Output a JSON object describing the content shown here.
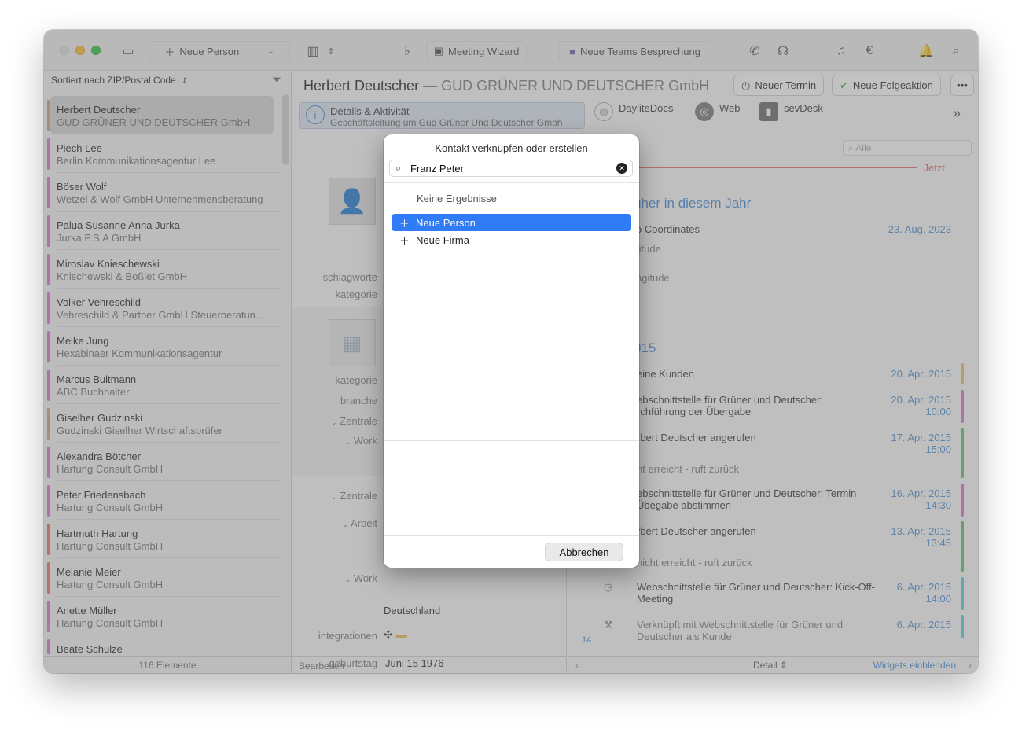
{
  "toolbar": {
    "new_person": "Neue Person",
    "meeting_wizard": "Meeting Wizard",
    "teams_meeting": "Neue Teams Besprechung"
  },
  "sidebar": {
    "sort_label": "Sortiert nach ZIP/Postal Code",
    "footer": "116 Elemente",
    "items": [
      {
        "name": "Herbert Deutscher",
        "company": "GUD GRÜNER UND DEUTSCHER GmbH",
        "color": "#c9a07a"
      },
      {
        "name": "Piech Lee",
        "company": "Berlin Kommunikationsagentur Lee",
        "color": "#d86fd6"
      },
      {
        "name": "Böser Wolf",
        "company": "Wetzel & Wolf GmbH Unternehmensberatung",
        "color": "#d86fd6"
      },
      {
        "name": "Palua Susanne Anna Jurka",
        "company": "Jurka P.S.A GmbH",
        "color": "#d86fd6"
      },
      {
        "name": "Miroslav Knieschewski",
        "company": "Knischewski & Boßlet GmbH",
        "color": "#d86fd6"
      },
      {
        "name": "Volker Vehreschild",
        "company": "Vehreschild & Partner GmbH Steuerberatun...",
        "color": "#d86fd6"
      },
      {
        "name": "Meike Jung",
        "company": "Hexabinaer Kommunikationsagentur",
        "color": "#d86fd6"
      },
      {
        "name": "Marcus Bultmann",
        "company": "ABC Buchhalter",
        "color": "#d86fd6"
      },
      {
        "name": "Giselher Gudzinski",
        "company": "Gudzinski Giselher Wirtschaftsprüfer",
        "color": "#c9a07a"
      },
      {
        "name": "Alexandra Bötcher",
        "company": "Hartung Consult GmbH",
        "color": "#d86fd6"
      },
      {
        "name": "Peter Friedensbach",
        "company": "Hartung Consult GmbH",
        "color": "#d86fd6"
      },
      {
        "name": "Hartmuth Hartung",
        "company": "Hartung Consult GmbH",
        "color": "#e8705a"
      },
      {
        "name": "Melanie Meier",
        "company": "Hartung Consult GmbH",
        "color": "#e8705a"
      },
      {
        "name": "Anette Müller",
        "company": "Hartung Consult GmbH",
        "color": "#d86fd6"
      },
      {
        "name": "Beate Schulze",
        "company": "",
        "color": "#d86fd6"
      }
    ]
  },
  "main": {
    "person": "Herbert Deutscher",
    "company_sep": " — GUD GRÜNER UND DEUTSCHER GmbH",
    "btn_termin": "Neuer Termin",
    "btn_folge": "Neue Folgeaktion",
    "tabs": {
      "details": "Details & Aktivität",
      "details_sub": "Geschäftsleitung um Gud Grüner Und Deutscher Gmbh",
      "daylite": "DayliteDocs",
      "web": "Web",
      "sevdesk": "sevDesk"
    },
    "fields": {
      "schlagworte": "schlagworte",
      "kategorie": "kategorie",
      "kategorie2": "kategorie",
      "branche": "branche",
      "zentrale": "Zentrale",
      "work": "Work",
      "zentrale2": "Zentrale",
      "arbeit": "Arbeit",
      "work2": "Work",
      "country": "Deutschland",
      "integrationen": "integrationen",
      "geburtstag": "geburtstag",
      "geburtstag_val": "Juni  15   1976"
    },
    "footer_edit": "Bearbeiten",
    "footer_detail": "Detail",
    "footer_widgets": "Widgets einblenden"
  },
  "timeline": {
    "filter_placeholder": "Alle",
    "now": "Jetzt",
    "section1": "üher in diesem Jahr",
    "section2": "015",
    "geo": "o Coordinates",
    "geo_date": "23. Aug. 2023",
    "latitude": "titude",
    "longitude": "ngitude",
    "items": [
      {
        "text": "eine Kunden",
        "date": "20. Apr. 2015",
        "time": "",
        "color": "#f0b85a"
      },
      {
        "text": "ebschnittstelle für Grüner und Deutscher: rchführung der Übergabe",
        "date": "20. Apr. 2015",
        "time": "10:00",
        "color": "#d86fd6"
      },
      {
        "text": "rbert Deutscher angerufen",
        "date": "17. Apr. 2015",
        "time": "15:00",
        "sub": "ht erreicht - ruft zurück",
        "color": "#5cc05c"
      },
      {
        "text": "ebschnittstelle für Grüner und Deutscher: Termin Übegabe abstimmen",
        "date": "16. Apr. 2015",
        "time": "14:30",
        "color": "#d86fd6"
      },
      {
        "text": "rbert Deutscher angerufen",
        "date": "13. Apr. 2015",
        "time": "13:45",
        "sub": "nicht erreicht - ruft zurück",
        "color": "#5cc05c"
      },
      {
        "text": "Webschnittstelle für Grüner und Deutscher: Kick-Off-Meeting",
        "date": "6. Apr. 2015",
        "time": "14:00",
        "color": "#4fd0d8"
      },
      {
        "text": "Verknüpft mit Webschnittstelle für Grüner und Deutscher als Kunde",
        "date": "6. Apr. 2015",
        "time": "",
        "color": "#4fd0d8"
      }
    ],
    "day14": "14"
  },
  "dialog": {
    "title": "Kontakt verknüpfen oder erstellen",
    "search_value": "Franz Peter",
    "no_results": "Keine Ergebnisse",
    "opt_person": "Neue Person",
    "opt_firma": "Neue Firma",
    "cancel": "Abbrechen"
  }
}
